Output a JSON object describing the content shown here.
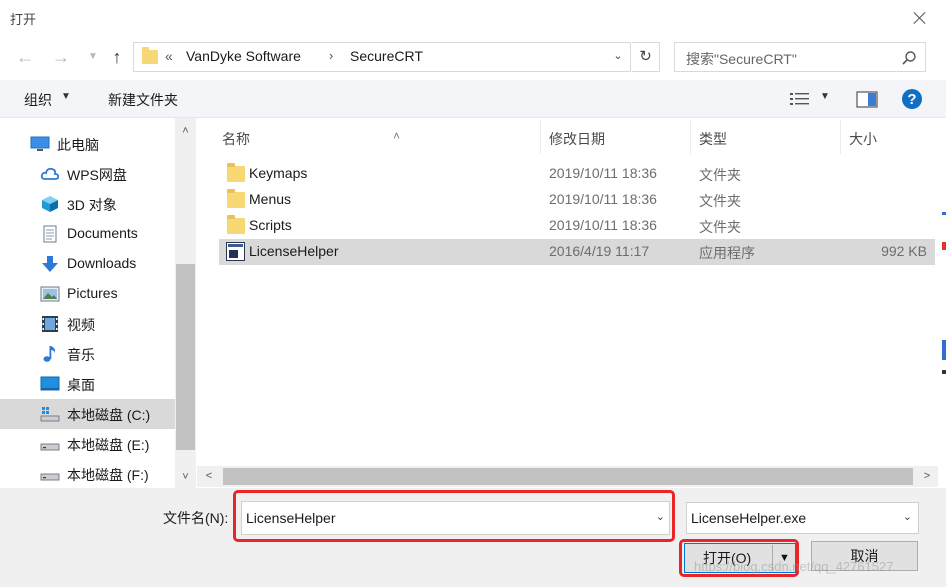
{
  "window": {
    "title": "打开"
  },
  "nav": {
    "back_icon": "arrow-left-icon",
    "forward_icon": "arrow-right-icon",
    "recent_icon": "chevron-down-icon",
    "up_icon": "arrow-up-icon",
    "breadcrumb_prefix": "«",
    "breadcrumb": [
      "VanDyke Software",
      "SecureCRT"
    ],
    "breadcrumb_separator": "›",
    "refresh_icon": "refresh-icon",
    "search_placeholder": "搜索\"SecureCRT\""
  },
  "toolbar": {
    "organize_label": "组织",
    "new_folder_label": "新建文件夹",
    "view_icon": "details-view-icon",
    "preview_icon": "preview-pane-icon",
    "help_icon": "help-icon"
  },
  "sidebar": {
    "items": [
      {
        "label": "此电脑",
        "icon": "computer-icon"
      },
      {
        "label": "WPS网盘",
        "icon": "cloud-icon"
      },
      {
        "label": "3D 对象",
        "icon": "cube-3d-icon"
      },
      {
        "label": "Documents",
        "icon": "document-icon"
      },
      {
        "label": "Downloads",
        "icon": "download-icon"
      },
      {
        "label": "Pictures",
        "icon": "picture-icon"
      },
      {
        "label": "视频",
        "icon": "video-icon"
      },
      {
        "label": "音乐",
        "icon": "music-icon"
      },
      {
        "label": "桌面",
        "icon": "desktop-icon"
      },
      {
        "label": "本地磁盘 (C:)",
        "icon": "system-drive-icon",
        "selected": true
      },
      {
        "label": "本地磁盘 (E:)",
        "icon": "drive-icon"
      },
      {
        "label": "本地磁盘 (F:)",
        "icon": "drive-icon"
      }
    ]
  },
  "filelist": {
    "columns": [
      "名称",
      "修改日期",
      "类型",
      "大小"
    ],
    "rows": [
      {
        "name": "Keymaps",
        "date": "2019/10/11 18:36",
        "type": "文件夹",
        "size": "",
        "icon": "folder-icon"
      },
      {
        "name": "Menus",
        "date": "2019/10/11 18:36",
        "type": "文件夹",
        "size": "",
        "icon": "folder-icon"
      },
      {
        "name": "Scripts",
        "date": "2019/10/11 18:36",
        "type": "文件夹",
        "size": "",
        "icon": "folder-icon"
      },
      {
        "name": "LicenseHelper",
        "date": "2016/4/19 11:17",
        "type": "应用程序",
        "size": "992 KB",
        "icon": "application-icon",
        "selected": true
      }
    ]
  },
  "bottom": {
    "filename_label": "文件名(N):",
    "filename_value": "LicenseHelper",
    "filetype_value": "LicenseHelper.exe",
    "open_label": "打开(O)",
    "cancel_label": "取消"
  },
  "watermark": "https://blog.csdn.net/qq_42761527",
  "colors": {
    "highlight_box": "#e8262a",
    "selection": "#d9d9d9",
    "folder": "#f8d775",
    "help_icon": "#0f6fc6"
  }
}
